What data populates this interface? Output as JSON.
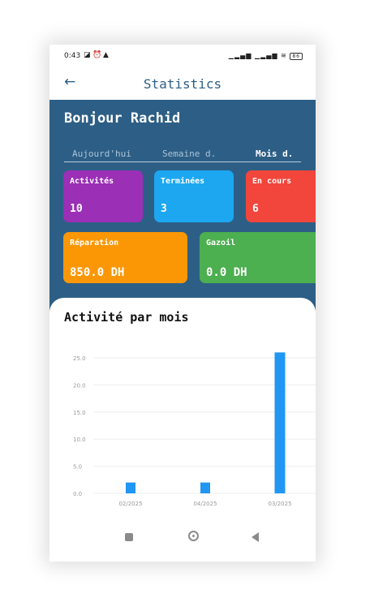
{
  "status_bar": {
    "time": "0:43",
    "left_icons": [
      "gallery-icon",
      "alarm-icon",
      "warning-icon"
    ],
    "right_icons": [
      "signal-icon",
      "signal-icon",
      "wifi-icon",
      "battery-icon"
    ],
    "battery": "86"
  },
  "app_bar": {
    "back_icon": "arrow-left-icon",
    "title": "Statistics"
  },
  "header": {
    "greeting": "Bonjour Rachid",
    "tabs": [
      {
        "label": "Aujourd'hui",
        "active": false
      },
      {
        "label": "Semaine d.",
        "active": false
      },
      {
        "label": "Mois d.",
        "active": true
      }
    ]
  },
  "cards": [
    {
      "label": "Activités",
      "value": "10",
      "color": "#9b2fb6"
    },
    {
      "label": "Terminées",
      "value": "3",
      "color": "#1da7f1"
    },
    {
      "label": "En cours",
      "value": "6",
      "color": "#f2453b"
    },
    {
      "label": "Réparation",
      "value": "850.0 DH",
      "color": "#fb9705"
    },
    {
      "label": "Gazoil",
      "value": "0.0 DH",
      "color": "#4caf50"
    }
  ],
  "chart": {
    "title": "Activité par mois"
  },
  "chart_data": {
    "type": "bar",
    "categories": [
      "02/2025",
      "04/2025",
      "03/2025"
    ],
    "values": [
      2,
      2,
      26
    ],
    "ylim": [
      0,
      25
    ],
    "yticks": [
      "0.0",
      "5.0",
      "10.0",
      "15.0",
      "20.0",
      "25.0"
    ],
    "bar_color": "#2196f3",
    "grid": true
  },
  "nav_bar": {
    "icons": [
      "recents-icon",
      "home-icon",
      "back-icon"
    ]
  }
}
